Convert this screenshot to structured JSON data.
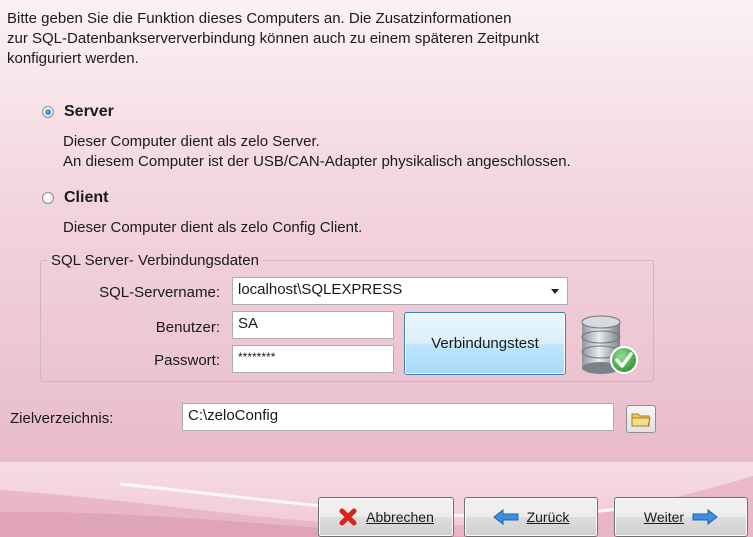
{
  "intro": {
    "line1": "Bitte geben Sie die Funktion dieses Computers an. Die Zusatzinformationen",
    "line2": "zur SQL-Datenbankserververbindung können auch zu einem späteren Zeitpunkt",
    "line3": "konfiguriert werden."
  },
  "server_option": {
    "label": "Server",
    "checked": true,
    "desc1": "Dieser Computer dient als zelo Server.",
    "desc2": "An diesem Computer ist der USB/CAN-Adapter physikalisch angeschlossen."
  },
  "client_option": {
    "label": "Client",
    "checked": false,
    "desc1": "Dieser Computer dient als zelo Config Client."
  },
  "sql_group": {
    "legend": "SQL Server- Verbindungsdaten",
    "servername_label": "SQL-Servername:",
    "servername_value": "localhost\\SQLEXPRESS",
    "user_label": "Benutzer:",
    "user_value": "SA",
    "password_label": "Passwort:",
    "password_value": "********",
    "test_button": "Verbindungstest",
    "status_icon": "database-check-icon"
  },
  "target": {
    "label": "Zielverzeichnis:",
    "value": "C:\\zeloConfig",
    "browse_icon": "folder-icon"
  },
  "buttons": {
    "cancel": "Abbrechen",
    "back": "Zurück",
    "next": "Weiter"
  },
  "colors": {
    "accent_blue": "#1e5fb3",
    "cancel_red": "#d9221c",
    "check_green": "#3aa63a"
  }
}
